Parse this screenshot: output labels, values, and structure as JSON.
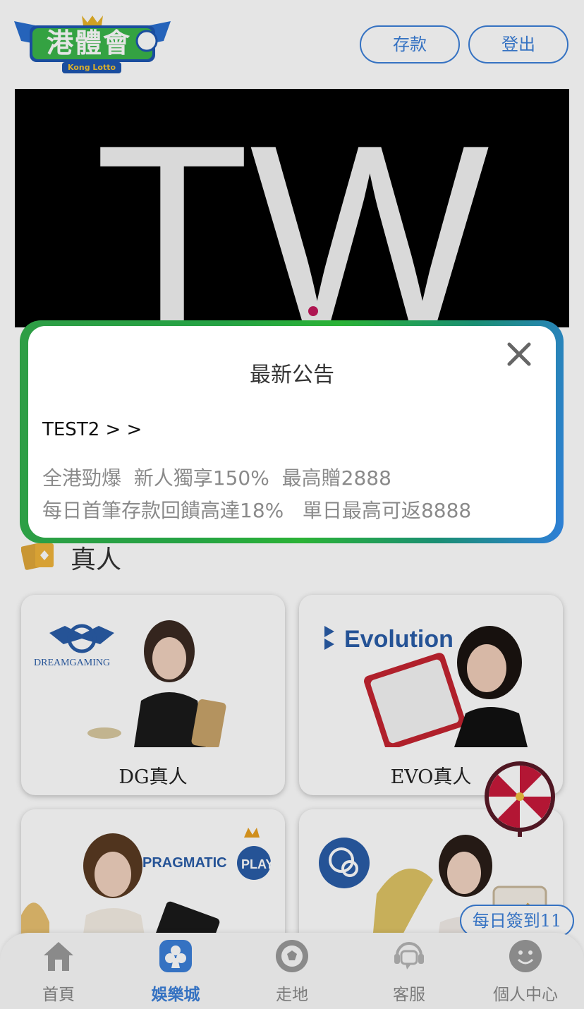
{
  "header": {
    "logo_text": "港體會",
    "logo_subtext": "Kong Lotto",
    "deposit_label": "存款",
    "logout_label": "登出"
  },
  "banner": {
    "text": "TW"
  },
  "section": {
    "title": "真人"
  },
  "games": [
    {
      "label": "DG真人",
      "brand": "DREAMGAMING"
    },
    {
      "label": "EVO真人",
      "brand": "Evolution"
    },
    {
      "label": "",
      "brand": "PRAGMATIC PLAY"
    },
    {
      "label": "",
      "brand": "OB"
    }
  ],
  "floating": {
    "daily_checkin": "每日簽到11"
  },
  "nav": {
    "items": [
      {
        "label": "首頁",
        "icon": "home-icon"
      },
      {
        "label": "娛樂城",
        "icon": "club-icon",
        "active": true
      },
      {
        "label": "走地",
        "icon": "soccer-ball-icon"
      },
      {
        "label": "客服",
        "icon": "chat-support-icon"
      },
      {
        "label": "個人中心",
        "icon": "smiley-icon"
      }
    ]
  },
  "modal": {
    "title": "最新公告",
    "notice_head": "TEST2  > >",
    "lines": [
      "全港勁爆  新人獨享150%  最高贈2888",
      "每日首筆存款回饋高達18%   單日最高可返8888"
    ]
  },
  "colors": {
    "accent": "#3b7fd9",
    "banner_dot": "#c2185b"
  }
}
